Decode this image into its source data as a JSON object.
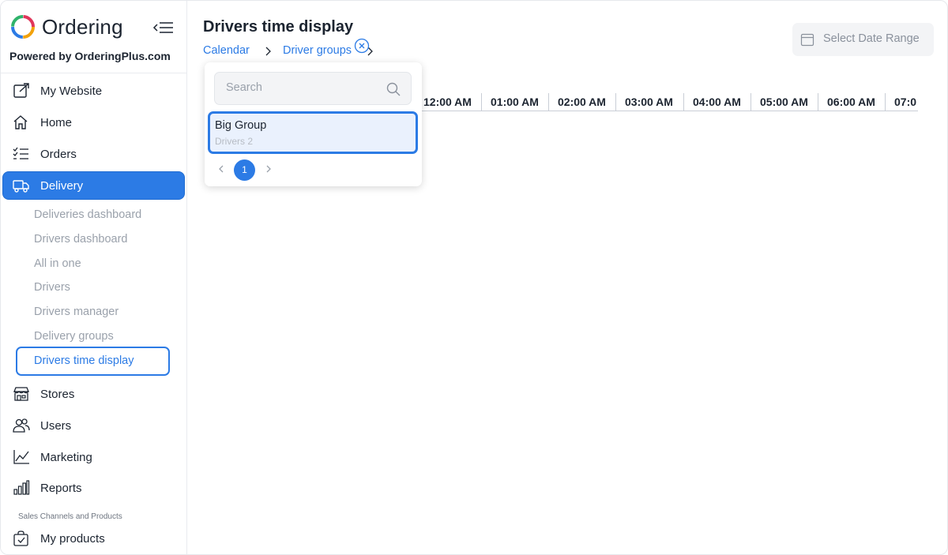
{
  "brand": {
    "name": "Ordering",
    "powered_by": "Powered by OrderingPlus.com"
  },
  "sidebar": {
    "items": [
      {
        "label": "My Website",
        "icon": "external-link-icon"
      },
      {
        "label": "Home",
        "icon": "home-icon"
      },
      {
        "label": "Orders",
        "icon": "list-check-icon"
      },
      {
        "label": "Delivery",
        "icon": "truck-icon",
        "active": true
      },
      {
        "label": "Stores",
        "icon": "shop-icon"
      },
      {
        "label": "Users",
        "icon": "users-icon"
      },
      {
        "label": "Marketing",
        "icon": "graph-up-icon"
      },
      {
        "label": "Reports",
        "icon": "bar-chart-icon"
      },
      {
        "label": "My products",
        "icon": "bag-check-icon"
      }
    ],
    "delivery_sub": [
      "Deliveries dashboard",
      "Drivers dashboard",
      "All in one",
      "Drivers",
      "Drivers manager",
      "Delivery groups",
      "Drivers time display"
    ],
    "current_sub": "Drivers time display",
    "section_label": "Sales Channels and Products"
  },
  "header": {
    "title": "Drivers time display",
    "breadcrumb": [
      "Calendar",
      "Driver groups"
    ],
    "date_range_label": "Select Date Range"
  },
  "timeline": {
    "hours": [
      "12:00 AM",
      "01:00 AM",
      "02:00 AM",
      "03:00 AM",
      "04:00 AM",
      "05:00 AM",
      "06:00 AM",
      "07:0"
    ]
  },
  "dropdown": {
    "search_placeholder": "Search",
    "options": [
      {
        "name": "Big Group",
        "sub": "Drivers 2"
      }
    ],
    "page": "1"
  },
  "colors": {
    "accent": "#2c7be5",
    "muted": "#9aa1ab",
    "text": "#1c2430"
  }
}
